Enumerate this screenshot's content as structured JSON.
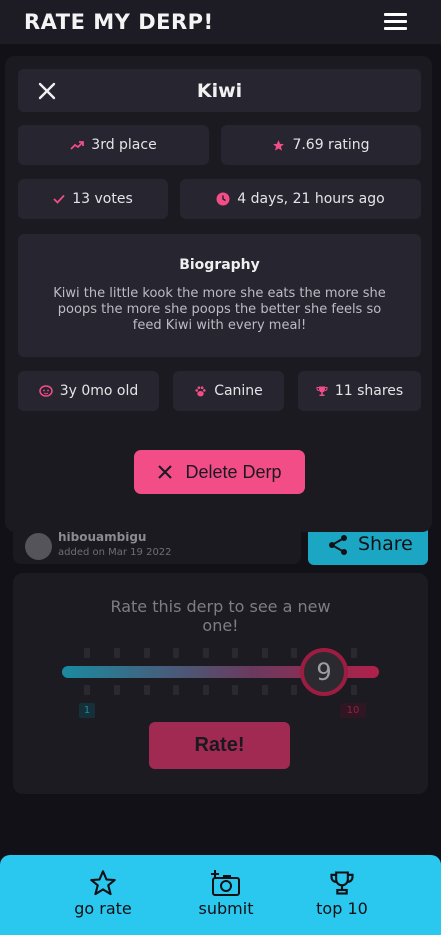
{
  "app": {
    "brand": "RATE MY DERP!"
  },
  "background": {
    "user_name": "hibouambigu",
    "added_on": "added on Mar 19 2022",
    "share_label": "Share",
    "rate_prompt": "Rate this derp to see a new one!",
    "slider": {
      "value": "9",
      "min": "1",
      "max": "10"
    },
    "rate_button": "Rate!"
  },
  "modal": {
    "title": "Kiwi",
    "place": "3rd place",
    "rating": "7.69 rating",
    "votes": "13 votes",
    "time_ago": "4 days, 21 hours ago",
    "bio_title": "Biography",
    "bio_text": "Kiwi the little kook the more she eats the more she poops the more she poops the better she feels so feed Kiwi with every meal!",
    "age": "3y 0mo old",
    "species": "Canine",
    "shares": "11 shares",
    "delete_button": "Delete Derp"
  },
  "nav": {
    "go_rate": "go rate",
    "submit": "submit",
    "top10": "top 10"
  },
  "colors": {
    "accent_pink": "#f24d87",
    "accent_cyan": "#2ac8ef",
    "background": "#121118"
  }
}
